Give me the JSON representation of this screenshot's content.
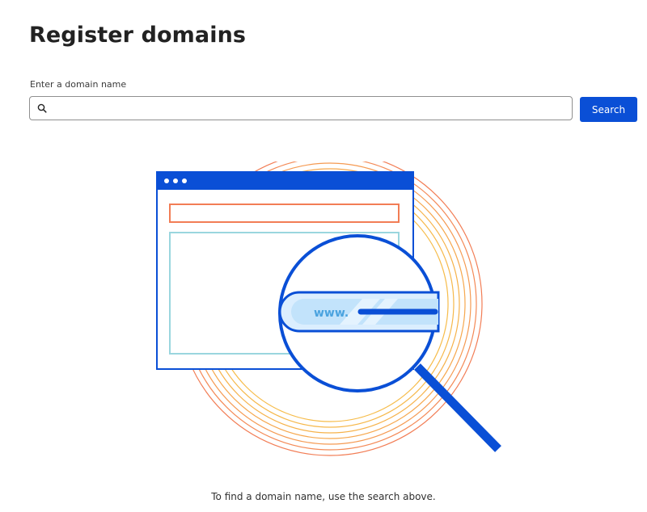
{
  "header": {
    "title": "Register domains"
  },
  "search": {
    "label": "Enter a domain name",
    "value": "",
    "placeholder": "",
    "button_label": "Search",
    "icon": "search-icon"
  },
  "illustration": {
    "address_text": "www.",
    "icon": "domain-search-illustration"
  },
  "empty_state": {
    "message": "To find a domain name, use the search above."
  },
  "colors": {
    "accent": "#0a4fd6",
    "ring_orange": "#f27d55",
    "ring_yellow": "#f6b24a",
    "frame_teal": "#9ad6de"
  }
}
